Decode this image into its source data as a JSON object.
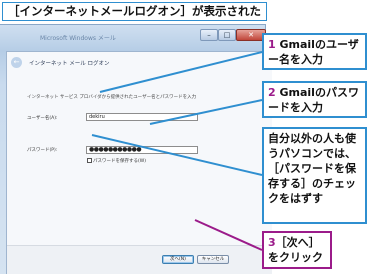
{
  "caption": "［インターネットメールログオン］が表示された",
  "window": {
    "title": "Microsoft Windows メール",
    "controls": {
      "minimize": "–",
      "maximize": "□",
      "close": "✕"
    }
  },
  "wizard": {
    "back": "←",
    "title": "インターネット メール ログオン",
    "description": "インターネット サービス プロバイダから提供されたユーザー名とパスワードを入力",
    "username_label": "ユーザー名(A):",
    "username_value": "dekiru",
    "password_label": "パスワード(P):",
    "password_value": "●●●●●●●●●●●",
    "remember_label": "パスワードを保存する(W)",
    "next_button": "次へ(N)",
    "cancel_button": "キャンセル"
  },
  "callouts": {
    "step1_num": "1",
    "step1_text_line1": " Gmailのユーザ",
    "step1_text_line2": "ー名を入力",
    "step2_num": "2",
    "step2_text_line1": " Gmailのパスワ",
    "step2_text_line2": "ードを入力",
    "note_lines": [
      "自分以外の人も使",
      "うパソコンでは、",
      "［パスワードを保",
      "存する］のチェッ",
      "クをはずす"
    ],
    "step3_num": "3",
    "step3_text_line1": "［次へ］",
    "step3_text_line2": "をクリック"
  },
  "colors": {
    "frame": "#2f8fd0",
    "accent": "#9b1b8a"
  }
}
